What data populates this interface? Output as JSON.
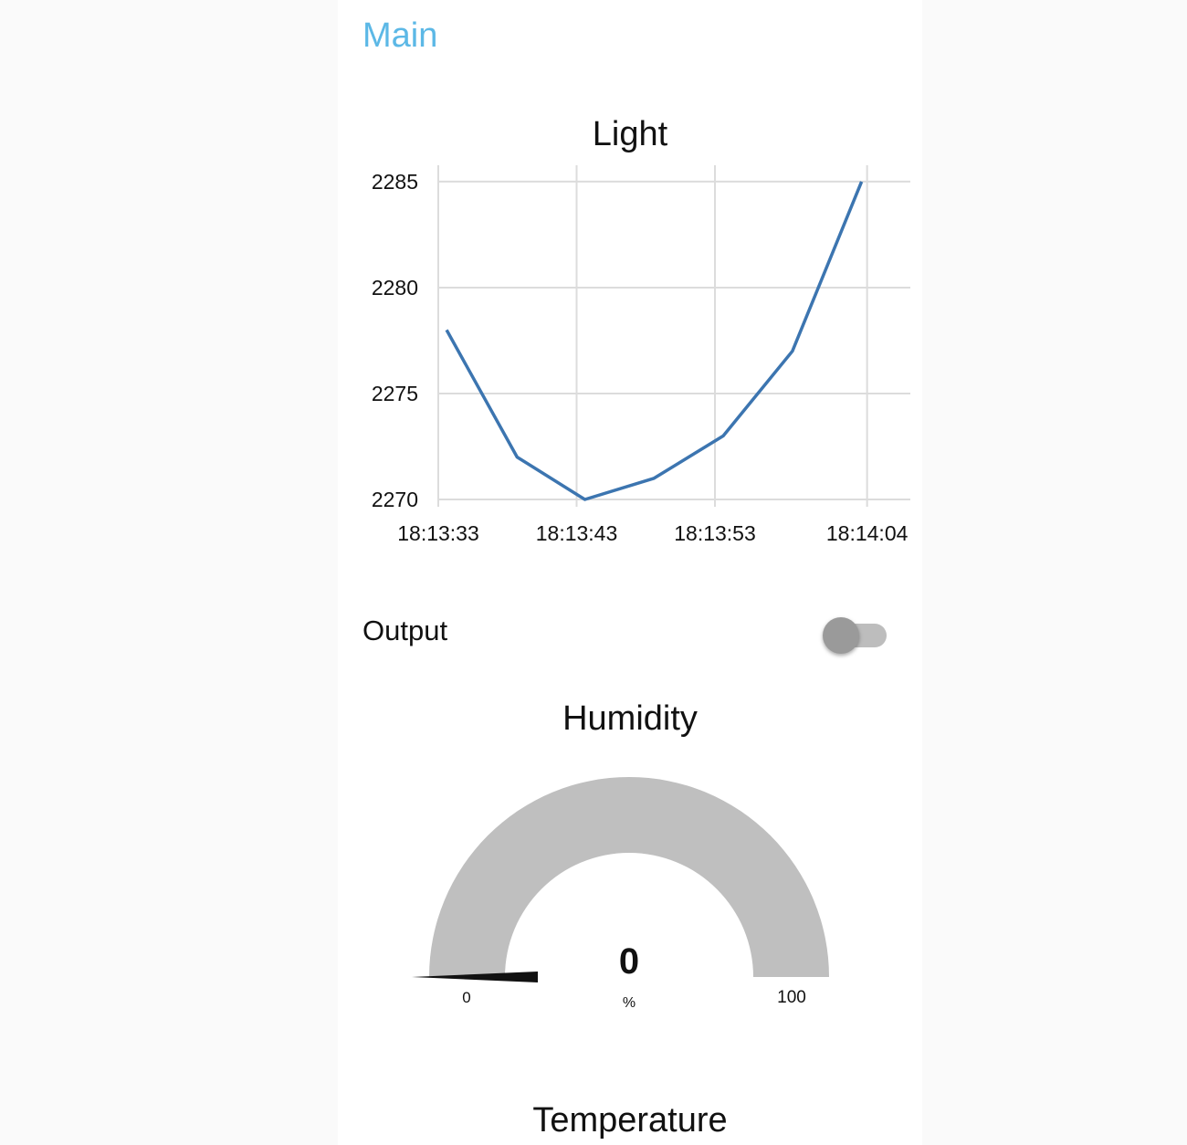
{
  "header": {
    "title": "Main"
  },
  "light_chart": {
    "title": "Light",
    "line_color": "#3c75b0",
    "chart_data": {
      "type": "line",
      "title": "Light",
      "xlabel": "",
      "ylabel": "",
      "x_tick_labels": [
        "18:13:33",
        "18:13:43",
        "18:13:53",
        "18:14:04"
      ],
      "x_tick_seconds": [
        0,
        10,
        20,
        31
      ],
      "y_ticks": [
        2270,
        2275,
        2280,
        2285
      ],
      "ylim": [
        2270,
        2285.6
      ],
      "xlim_seconds": [
        0,
        34
      ],
      "grid": true,
      "series": [
        {
          "x_seconds": [
            0.6,
            5.7,
            10.6,
            15.6,
            20.6,
            25.6,
            30.6
          ],
          "values": [
            2278,
            2272,
            2270,
            2271,
            2273,
            2277,
            2285
          ]
        }
      ]
    }
  },
  "output_switch": {
    "label": "Output",
    "state": "off"
  },
  "humidity_gauge": {
    "title": "Humidity",
    "value": "0",
    "units": "%",
    "min_label": "0",
    "max_label": "100",
    "fill_fraction": 0,
    "track_color": "#bfbfbf",
    "needle_color": "#111111"
  },
  "temperature": {
    "title": "Temperature"
  }
}
